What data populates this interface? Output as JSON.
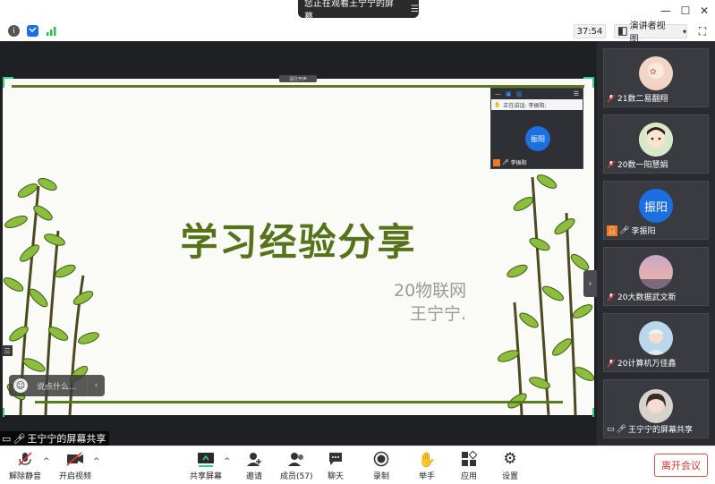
{
  "window": {
    "share_banner": "您正在观看王宁宁的屏幕",
    "menu_glyph": "☰",
    "minimize": "—",
    "maximize": "☐",
    "close": "✕"
  },
  "infobar": {
    "timer": "37:54",
    "view_mode": "演讲者视图",
    "view_caret": "▾",
    "fullscreen_glyph": "⛶"
  },
  "slide": {
    "title": "学习经验分享",
    "subtitle_line1": "20物联网",
    "subtitle_line2": "王宁宁."
  },
  "share_tag": "请打开声",
  "popup": {
    "speaking": "正在讲话: 李振阳;",
    "avatar_text": "振阳",
    "name": "李振阳"
  },
  "chat": {
    "placeholder": "说点什么..."
  },
  "sharer_label": "王宁宁的屏幕共享",
  "gallery": {
    "tiles": [
      {
        "name": "21数二易翻翔"
      },
      {
        "name": "20数一阳慧娟"
      },
      {
        "name": "李振阳",
        "avatar_text": "振阳"
      },
      {
        "name": "20大数据武文新"
      },
      {
        "name": "20计算机万佳鑫"
      },
      {
        "name": "王宁宁的屏幕共享"
      }
    ]
  },
  "toolbar": {
    "unmute": "解除静音",
    "start_video": "开启视频",
    "share_screen": "共享屏幕",
    "invite": "邀请",
    "members": "成员(57)",
    "chat": "聊天",
    "record": "录制",
    "raise_hand": "举手",
    "apps": "应用",
    "settings": "设置",
    "leave": "离开会议"
  },
  "colors": {
    "accent_blue": "#1b6fe0",
    "slide_green": "#56731a",
    "leave_red": "#e03030",
    "frame_green": "#2fd48a"
  }
}
